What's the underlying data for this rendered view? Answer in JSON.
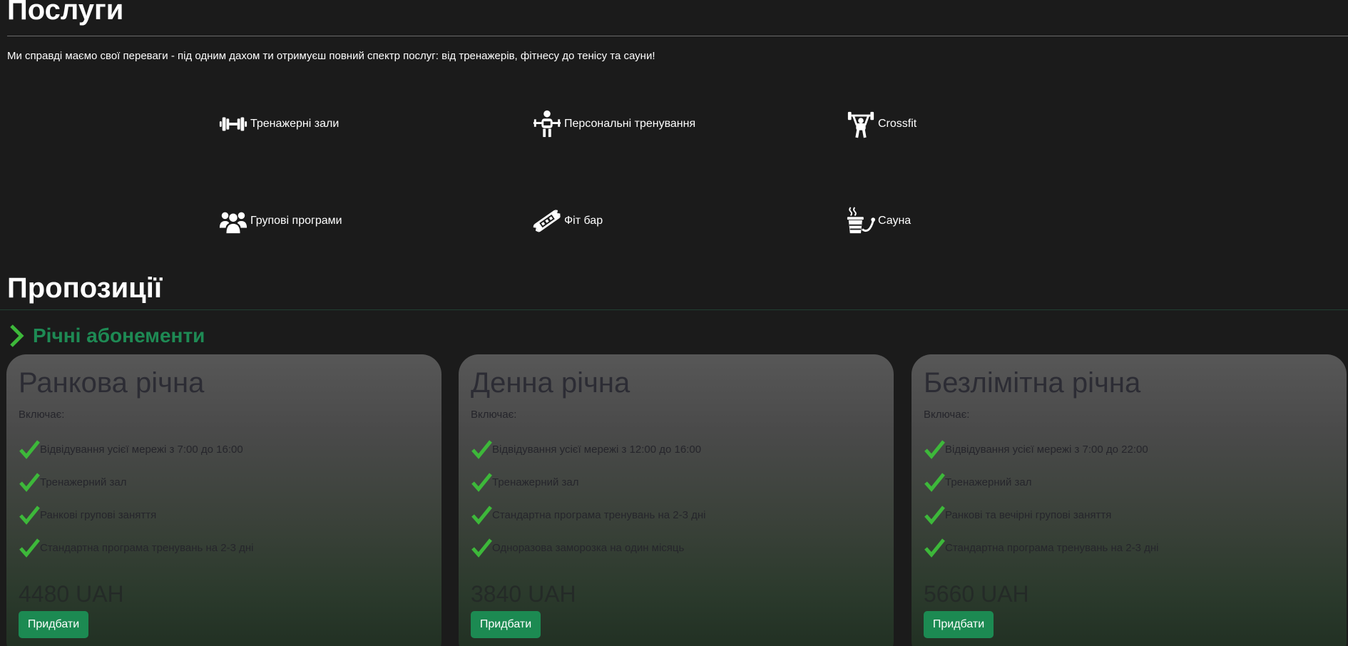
{
  "services": {
    "title": "Послуги",
    "intro": "Ми справді маємо свої переваги - під одним дахом ти отримуєш повний спектр послуг: від тренажерів, фітнесу до тенісу та сауни!",
    "items": [
      {
        "label": "Тренажерні зали",
        "icon": "dumbbell-icon"
      },
      {
        "label": "Персональні тренування",
        "icon": "personal-trainer-icon"
      },
      {
        "label": "Crossfit",
        "icon": "weightlifter-icon"
      },
      {
        "label": "Групові програми",
        "icon": "group-icon"
      },
      {
        "label": "Фіт бар",
        "icon": "protein-bar-icon"
      },
      {
        "label": "Сауна",
        "icon": "sauna-bucket-icon"
      }
    ]
  },
  "offers": {
    "title": "Пропозиції",
    "subtitle": "Річні абонементи",
    "accent": "#1e8a54",
    "cards": [
      {
        "title": "Ранкова річна",
        "includes_label": "Включає:",
        "features": [
          "Відвідування усієї мережі з 7:00 до 16:00",
          "Тренажерний зал",
          "Ранкові групові заняття",
          "Стандартна програма тренувань на 2-3 дні"
        ],
        "price": "4480 UAH",
        "button": "Придбати"
      },
      {
        "title": "Денна річна",
        "includes_label": "Включає:",
        "features": [
          "Відвідування усієї мережі з 12:00 до 16:00",
          "Тренажерний зал",
          "Стандартна програма тренувань на 2-3 дні",
          "Одноразова заморозка на один місяць"
        ],
        "price": "3840 UAH",
        "button": "Придбати"
      },
      {
        "title": "Безлімітна річна",
        "includes_label": "Включає:",
        "features": [
          "Відвідування усієї мережі з 7:00 до 22:00",
          "Тренажерний зал",
          "Ранкові та вечірні групові заняття",
          "Стандартна програма тренувань на 2-3 дні"
        ],
        "price": "5660 UAH",
        "button": "Придбати"
      }
    ]
  },
  "colors": {
    "background": "#1b1b1b",
    "check": "#3db83a",
    "button": "#1c8a52"
  }
}
